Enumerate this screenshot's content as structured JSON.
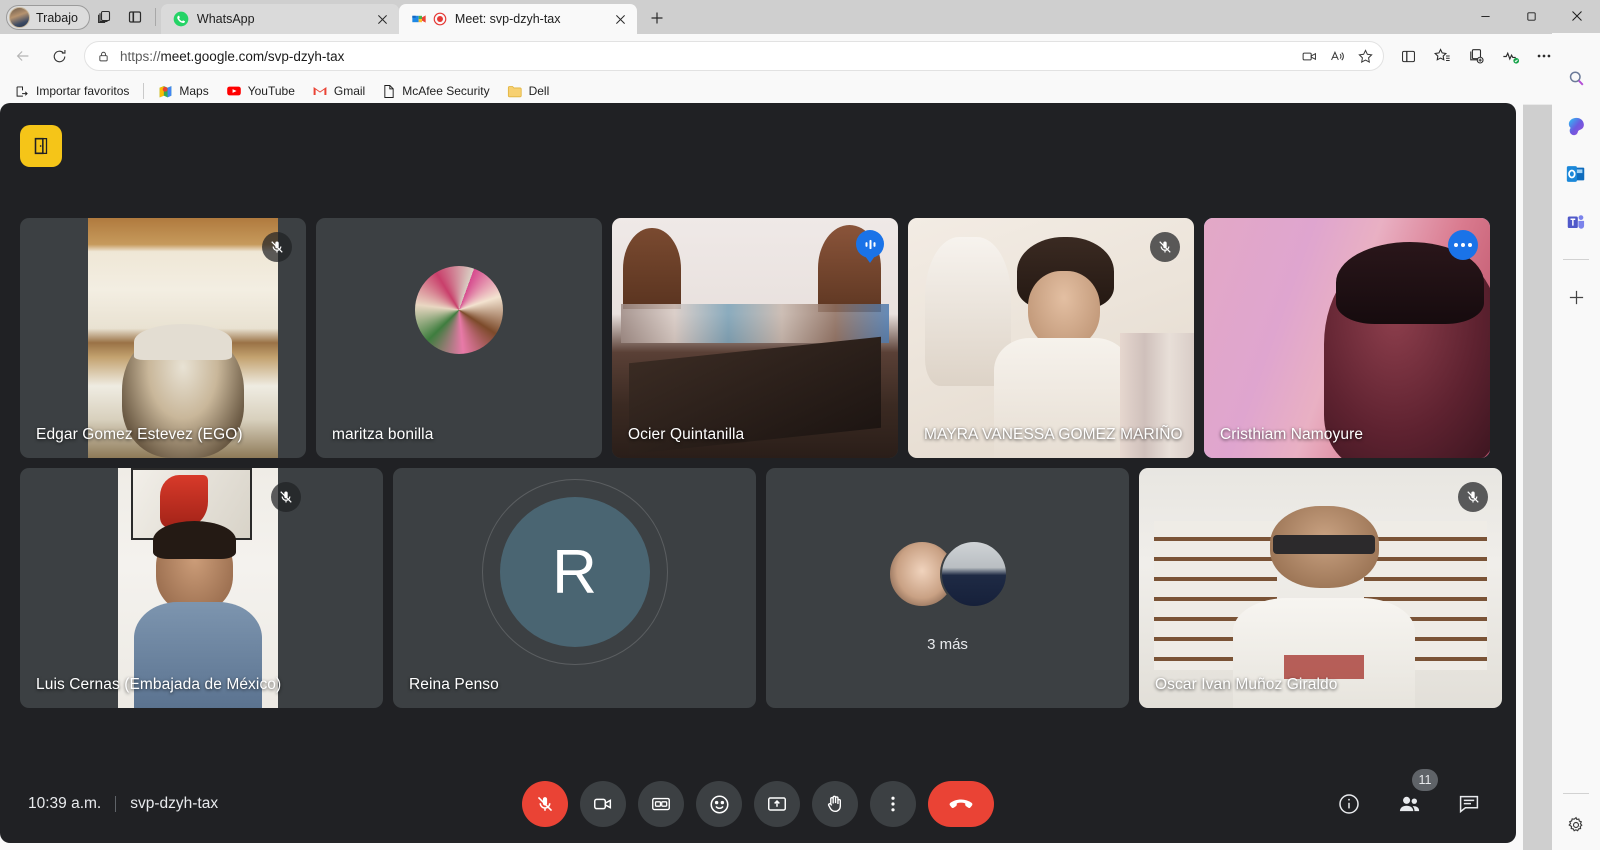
{
  "browser": {
    "profile": {
      "label": "Trabajo",
      "icon": "avatar-icon"
    },
    "tabstrip_icons": [
      "tab-collections-icon",
      "split-screen-icon"
    ],
    "tabs": [
      {
        "title": "WhatsApp",
        "favicon": "whatsapp-icon",
        "active": false
      },
      {
        "title": "Meet: svp-dzyh-tax",
        "favicon": "google-meet-icon",
        "recording": true,
        "active": true
      }
    ],
    "new_tab_label": "+",
    "window_controls": [
      "minimize",
      "maximize",
      "close"
    ],
    "nav": {
      "back": "back-arrow-icon",
      "refresh": "refresh-icon"
    },
    "address": {
      "lock": "lock-icon",
      "url_prefix": "https://",
      "url_main": "meet.google.com/svp-dzyh-tax",
      "full_url": "https://meet.google.com/svp-dzyh-tax",
      "inline_icons": [
        "camera-icon",
        "read-aloud-icon",
        "favorite-star-icon"
      ]
    },
    "toolbar_icons": [
      "split-screen-icon",
      "favorites-icon",
      "collections-icon",
      "browser-essentials-icon",
      "settings-more-icon",
      "copilot-icon"
    ],
    "bookmarks": [
      {
        "label": "Importar favoritos",
        "icon": "import-favorites-icon"
      },
      {
        "label": "Maps",
        "icon": "google-maps-icon"
      },
      {
        "label": "YouTube",
        "icon": "youtube-icon"
      },
      {
        "label": "Gmail",
        "icon": "gmail-icon"
      },
      {
        "label": "McAfee Security",
        "icon": "document-icon"
      },
      {
        "label": "Dell",
        "icon": "folder-icon"
      }
    ],
    "sidebar_icons": [
      "search-icon",
      "copilot-icon",
      "outlook-icon",
      "teams-icon",
      "add-icon",
      "settings-gear-icon"
    ]
  },
  "meet": {
    "logo": "door-exit-icon",
    "accent_highlight": "#8ab4f8",
    "mute_red": "#ea4335",
    "speaking_blue": "#1a73e8",
    "row1": [
      {
        "name": "Edgar Gomez Estevez (EGO)",
        "badge": "mic-muted-icon",
        "kind": "video"
      },
      {
        "name": "maritza bonilla",
        "badge": "",
        "kind": "photo-avatar"
      },
      {
        "name": "Ocier Quintanilla",
        "badge": "speaking-indicator-icon",
        "kind": "video"
      },
      {
        "name": "MAYRA VANESSA GOMEZ MARIÑO",
        "badge": "mic-muted-icon",
        "kind": "video"
      },
      {
        "name": "Cristhiam Namoyure",
        "badge": "more-options-icon",
        "kind": "video",
        "highlighted": true
      }
    ],
    "row2": [
      {
        "name": "Luis Cernas (Embajada de México)",
        "badge": "mic-muted-icon",
        "kind": "video"
      },
      {
        "name": "Reina Penso",
        "badge": "",
        "kind": "letter-avatar",
        "initial": "R"
      },
      {
        "name": "",
        "badge": "",
        "kind": "overflow",
        "overflow_label": "3 más"
      },
      {
        "name": "Oscar Ivan Muñoz Giraldo",
        "badge": "mic-muted-icon",
        "kind": "video"
      }
    ],
    "bottom": {
      "time": "10:39 a.m.",
      "code": "svp-dzyh-tax",
      "controls": [
        {
          "name": "microphone-muted-button",
          "icon": "mic-off-icon",
          "state": "muted"
        },
        {
          "name": "camera-button",
          "icon": "camera-icon",
          "state": "on"
        },
        {
          "name": "captions-button",
          "icon": "closed-captions-icon",
          "state": "off"
        },
        {
          "name": "reactions-button",
          "icon": "emoji-smiley-icon",
          "state": "off"
        },
        {
          "name": "present-button",
          "icon": "present-screen-icon",
          "state": "off"
        },
        {
          "name": "raise-hand-button",
          "icon": "raised-hand-icon",
          "state": "off"
        },
        {
          "name": "more-options-button",
          "icon": "three-dots-vertical-icon",
          "state": "off"
        },
        {
          "name": "leave-call-button",
          "icon": "hang-up-phone-icon",
          "state": "danger"
        }
      ],
      "right_controls": [
        {
          "name": "meeting-details-button",
          "icon": "info-circle-icon",
          "badge": ""
        },
        {
          "name": "participants-button",
          "icon": "people-icon",
          "badge": "11"
        },
        {
          "name": "chat-button",
          "icon": "chat-bubble-icon",
          "badge": ""
        }
      ]
    }
  }
}
